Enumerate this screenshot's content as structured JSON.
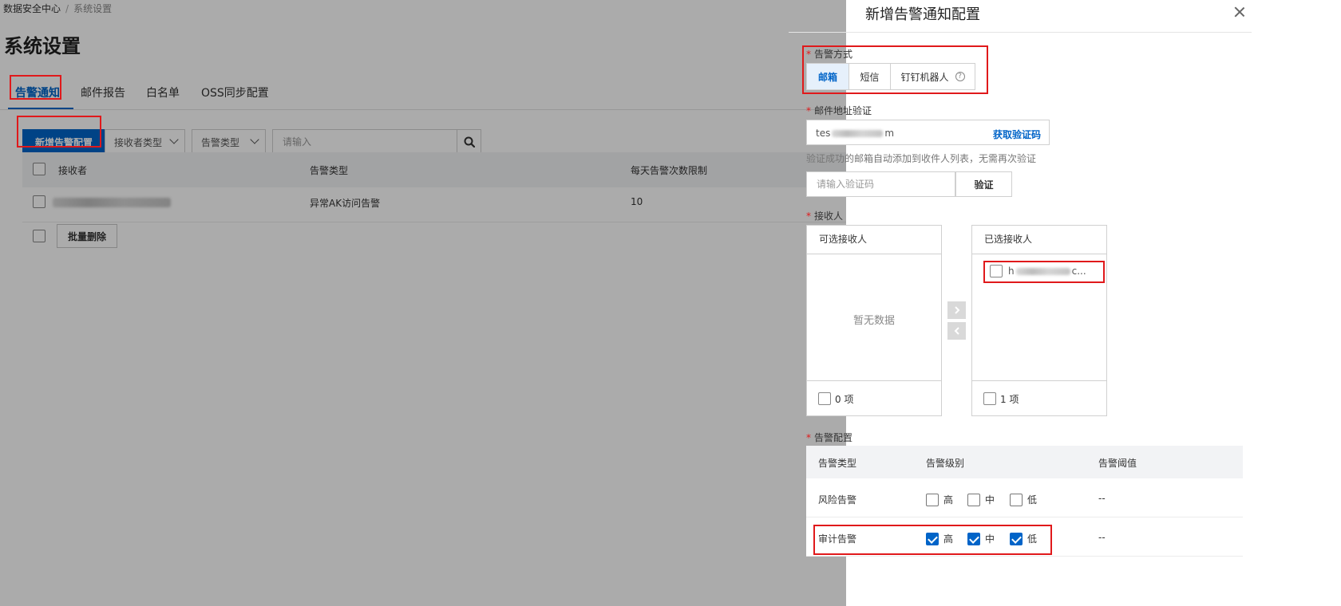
{
  "breadcrumb": {
    "root": "数据安全中心",
    "separator": "/",
    "current": "系统设置"
  },
  "page_title": "系统设置",
  "tabs": [
    {
      "label": "告警通知",
      "active": true
    },
    {
      "label": "邮件报告",
      "active": false
    },
    {
      "label": "白名单",
      "active": false
    },
    {
      "label": "OSS同步配置",
      "active": false
    }
  ],
  "toolbar": {
    "add_button": "新增告警配置",
    "receiver_type_select": "接收者类型",
    "alert_type_select": "告警类型",
    "search_placeholder": "请输入",
    "search_icon": "search-icon"
  },
  "table": {
    "columns": [
      "接收者",
      "告警类型",
      "每天告警次数限制"
    ],
    "rows": [
      {
        "receiver": "",
        "alert_type": "异常AK访问告警",
        "daily_limit": "10"
      }
    ],
    "batch_delete": "批量删除"
  },
  "drawer": {
    "title": "新增告警通知配置",
    "close_icon": "close-icon",
    "method": {
      "label": "告警方式",
      "options": [
        {
          "label": "邮箱",
          "active": true
        },
        {
          "label": "短信",
          "active": false
        },
        {
          "label": "钉钉机器人",
          "active": false,
          "help": "?"
        }
      ]
    },
    "email": {
      "label": "邮件地址验证",
      "value_prefix": "tes",
      "value_suffix": "m",
      "get_code": "获取验证码",
      "hint": "验证成功的邮箱自动添加到收件人列表，无需再次验证",
      "code_placeholder": "请输入验证码",
      "verify_button": "验证"
    },
    "receivers": {
      "label": "接收人",
      "available": {
        "title": "可选接收人",
        "empty": "暂无数据",
        "count": "0 项"
      },
      "selected": {
        "title": "已选接收人",
        "item_prefix": "h",
        "item_suffix": "c...",
        "count": "1 项"
      }
    },
    "alert_config": {
      "label": "告警配置",
      "columns": [
        "告警类型",
        "告警级别",
        "告警阈值"
      ],
      "levels": [
        "高",
        "中",
        "低"
      ],
      "rows": [
        {
          "type": "风险告警",
          "checked": [
            false,
            false,
            false
          ],
          "threshold": "--"
        },
        {
          "type": "审计告警",
          "checked": [
            true,
            true,
            true
          ],
          "threshold": "--"
        }
      ]
    }
  },
  "colors": {
    "primary": "#0064c8",
    "highlight": "#e0191b",
    "overlay": "rgba(0,0,0,0.33)"
  }
}
